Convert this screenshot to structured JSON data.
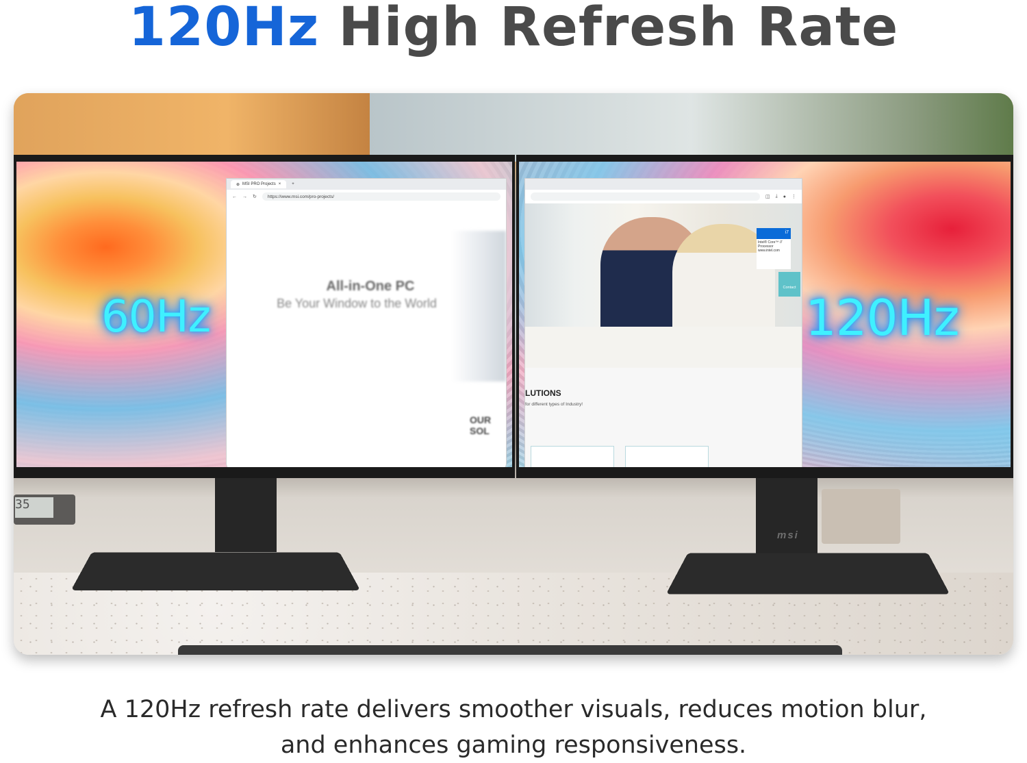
{
  "headline": {
    "accent": "120Hz",
    "rest": "High Refresh Rate"
  },
  "labels": {
    "left_rate": "60Hz",
    "right_rate": "120Hz"
  },
  "left_browser": {
    "tab_title": "MSI PRO Projects",
    "url": "https://www.msi.com/pro-projects/",
    "title": "All-in-One PC",
    "subtitle": "Be Your Window to the World",
    "section": "OUR SOL"
  },
  "right_browser": {
    "intel_badge": "Intel® Core™ i7 Processor www.intel.com",
    "intel_mark": "i7",
    "contact": "Contact",
    "section": "LUTIONS",
    "section_sub": "for different types of Industry!"
  },
  "brand": "msi",
  "clock_digits": "35",
  "caption": {
    "line1": "A 120Hz refresh rate delivers smoother visuals, reduces motion blur,",
    "line2": "and enhances gaming responsiveness."
  },
  "colors": {
    "accent_blue": "#1565d8",
    "headline_gray": "#4a4a4a",
    "glow_cyan": "#3ff0ff"
  }
}
